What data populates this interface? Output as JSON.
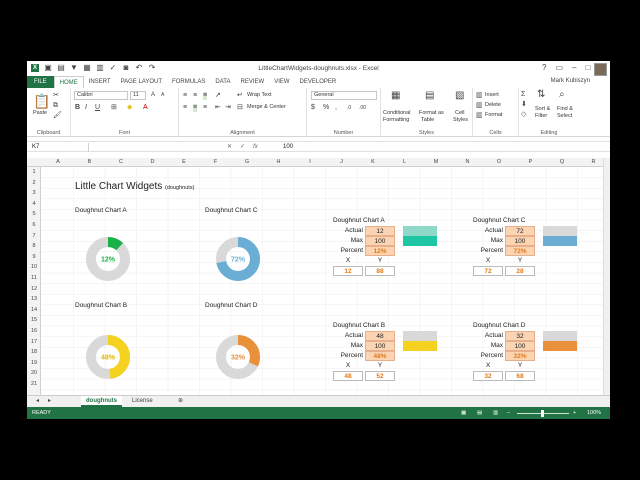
{
  "window": {
    "title": "LittleChartWidgets-doughnuts.xlsx - Excel",
    "user": "Mark Kubiszyn",
    "min_icon": "minimize-icon",
    "max_icon": "restore-icon",
    "close_icon": "close-icon"
  },
  "tabs": [
    "FILE",
    "HOME",
    "INSERT",
    "PAGE LAYOUT",
    "FORMULAS",
    "DATA",
    "REVIEW",
    "VIEW",
    "DEVELOPER"
  ],
  "ribbon": {
    "clipboard": {
      "label": "Clipboard",
      "paste": "Paste"
    },
    "font": {
      "label": "Font",
      "name": "Calibri",
      "size": "11"
    },
    "alignment": {
      "label": "Alignment",
      "wrap": "Wrap Text",
      "merge": "Merge & Center"
    },
    "number": {
      "label": "Number",
      "format": "General"
    },
    "styles": {
      "label": "Styles",
      "cond": "Conditional",
      "cond2": "Formatting",
      "fmt": "Format as",
      "fmt2": "Table",
      "cell": "Cell",
      "cell2": "Styles"
    },
    "cells": {
      "label": "Cells",
      "insert": "Insert",
      "delete": "Delete",
      "format": "Format"
    },
    "editing": {
      "label": "Editing",
      "sort": "Sort &",
      "sort2": "Filter",
      "find": "Find &",
      "find2": "Select"
    }
  },
  "formula_bar": {
    "name_box": "K7",
    "value": "100"
  },
  "columns": [
    "A",
    "B",
    "C",
    "D",
    "E",
    "F",
    "G",
    "H",
    "I",
    "J",
    "K",
    "L",
    "M",
    "N",
    "O",
    "P",
    "Q",
    "R"
  ],
  "rows": [
    "1",
    "2",
    "3",
    "4",
    "5",
    "6",
    "7",
    "8",
    "9",
    "10",
    "11",
    "12",
    "13",
    "14",
    "15",
    "16",
    "17",
    "18",
    "19",
    "20",
    "21"
  ],
  "sheet": {
    "title": "Little Chart Widgets",
    "subtitle": "(doughnuts)",
    "charts": [
      {
        "name": "Doughnut Chart A",
        "pct_label": "12%",
        "pct": 0.12,
        "color": "#1ab04a"
      },
      {
        "name": "Doughnut Chart B",
        "pct_label": "48%",
        "pct": 0.48,
        "color": "#f4d21f"
      },
      {
        "name": "Doughnut Chart C",
        "pct_label": "72%",
        "pct": 0.72,
        "color": "#6aaed6"
      },
      {
        "name": "Doughnut Chart D",
        "pct_label": "32%",
        "pct": 0.32,
        "color": "#e8913a"
      }
    ],
    "tables": [
      {
        "name": "Doughnut Chart A",
        "actual": "12",
        "max": "100",
        "percent": "12%",
        "x": "12",
        "y": "88",
        "sw1": "#8ed8c8",
        "sw2": "#1fc6a3"
      },
      {
        "name": "Doughnut Chart C",
        "actual": "72",
        "max": "100",
        "percent": "72%",
        "x": "72",
        "y": "28",
        "sw1": "#d9d9d9",
        "sw2": "#6aaed6"
      },
      {
        "name": "Doughnut Chart B",
        "actual": "48",
        "max": "100",
        "percent": "48%",
        "x": "48",
        "y": "52",
        "sw1": "#d9d9d9",
        "sw2": "#f4d21f"
      },
      {
        "name": "Doughnut Chart D",
        "actual": "32",
        "max": "100",
        "percent": "32%",
        "x": "32",
        "y": "68",
        "sw1": "#d9d9d9",
        "sw2": "#e8913a"
      }
    ],
    "labels": {
      "actual": "Actual",
      "max": "Max",
      "percent": "Percent",
      "x": "X",
      "y": "Y"
    }
  },
  "sheet_tabs": [
    "doughnuts",
    "License"
  ],
  "status": {
    "mode": "READY",
    "zoom": "100%"
  }
}
